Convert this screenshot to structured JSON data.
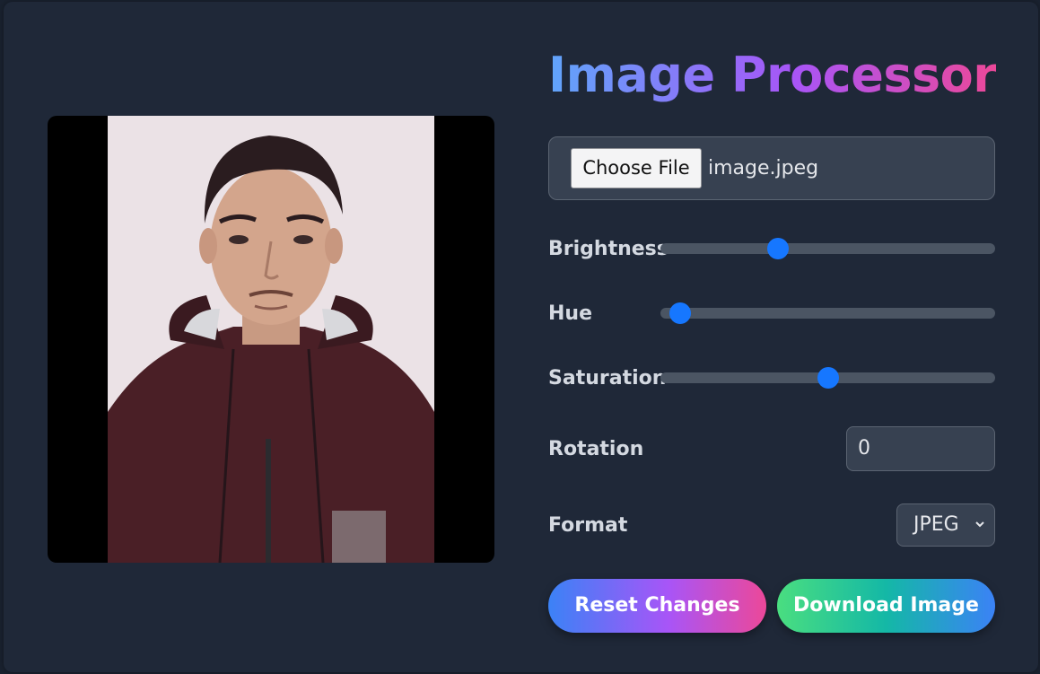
{
  "title": "Image Processor",
  "file": {
    "button_label": "Choose File",
    "file_name": "image.jpeg"
  },
  "controls": {
    "brightness": {
      "label": "Brightness",
      "value_fraction": 0.34
    },
    "hue": {
      "label": "Hue",
      "value_fraction": 0.03
    },
    "saturation": {
      "label": "Saturation",
      "value_fraction": 0.5
    },
    "rotation": {
      "label": "Rotation",
      "value": "0"
    },
    "format": {
      "label": "Format",
      "selected": "JPEG"
    }
  },
  "buttons": {
    "reset": "Reset Changes",
    "download": "Download Image"
  },
  "colors": {
    "background": "#1f2838",
    "slider_thumb": "#1677ff",
    "slider_track": "#4b5563"
  }
}
